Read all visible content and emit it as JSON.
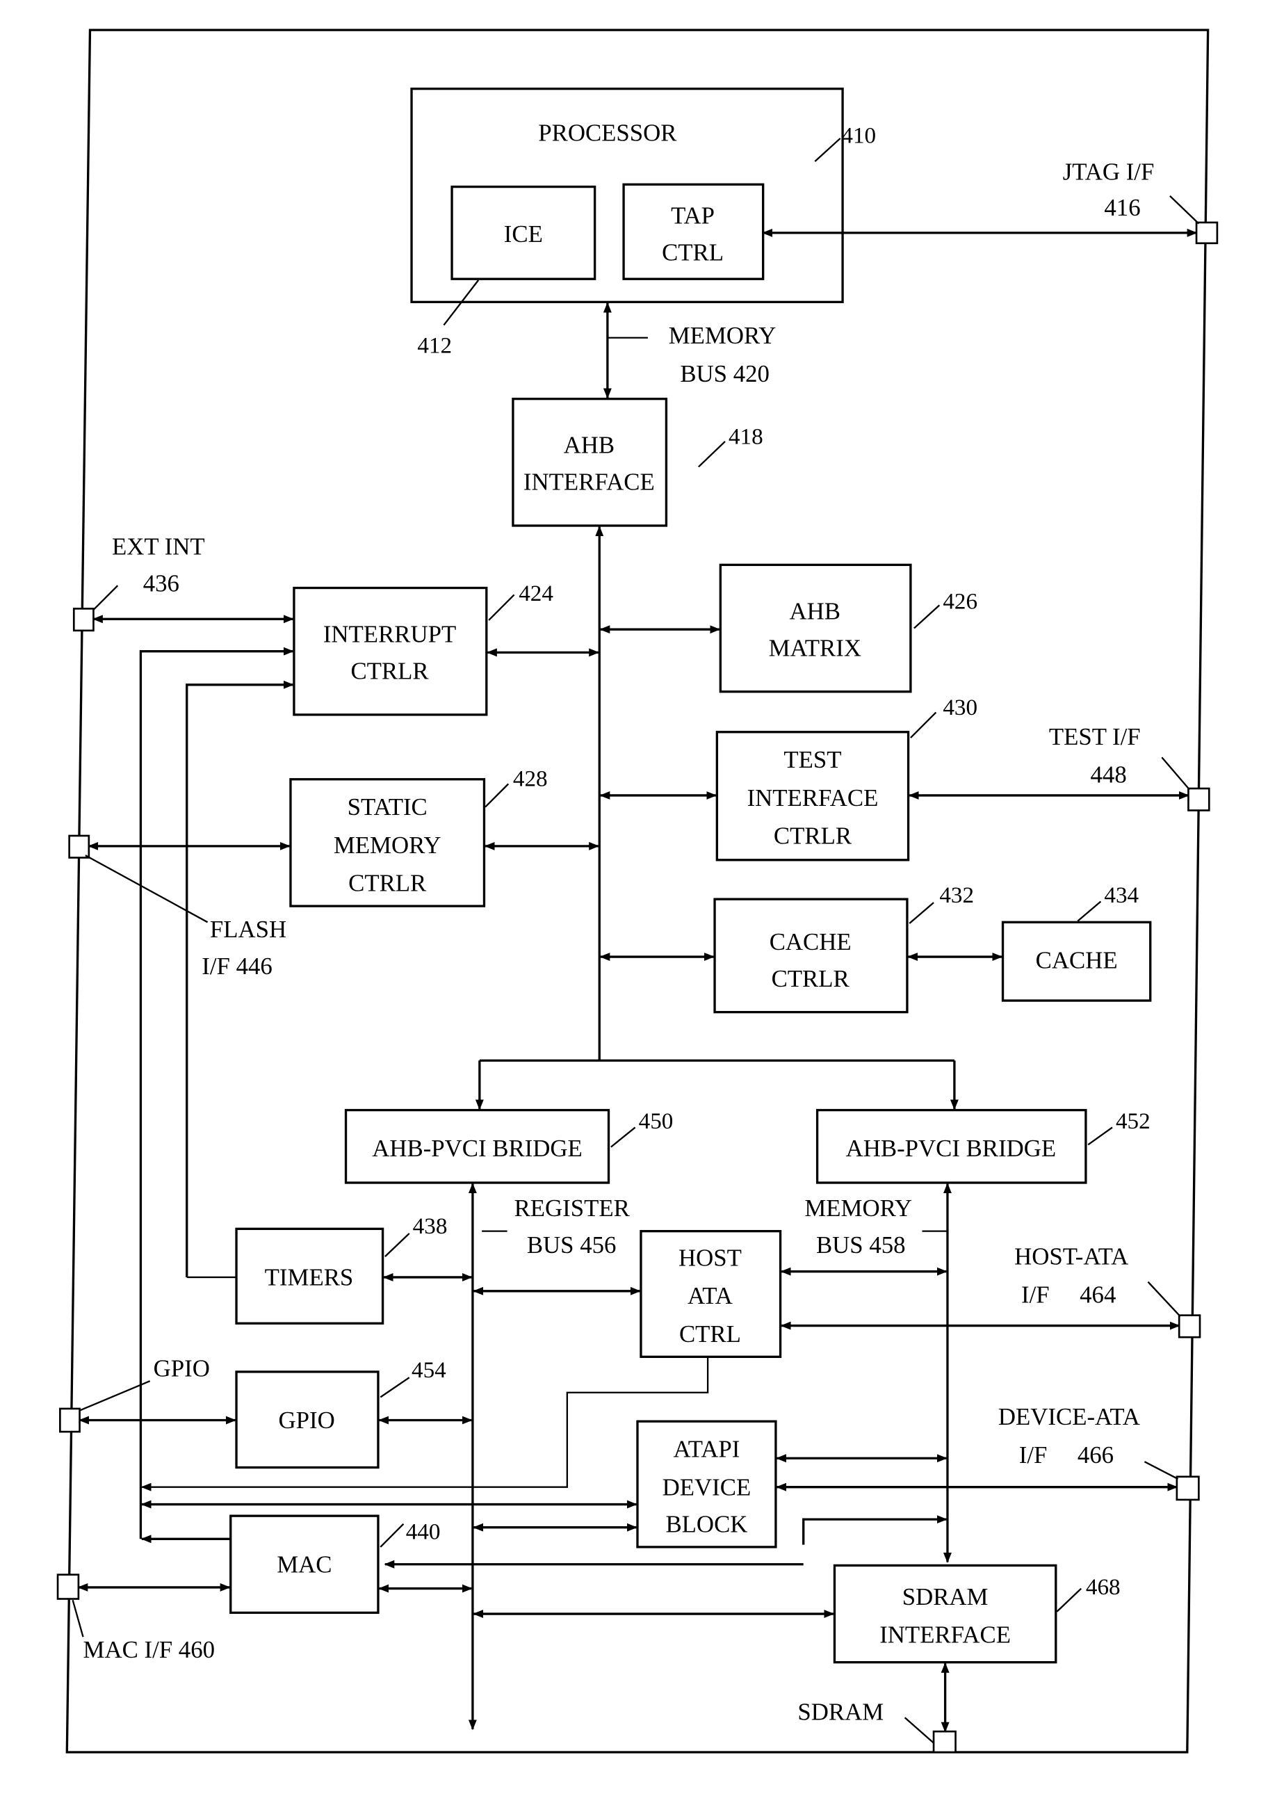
{
  "figure": {
    "blocks": {
      "processor": {
        "lines": [
          "PROCESSOR"
        ],
        "ref": "410"
      },
      "ice": {
        "lines": [
          "ICE"
        ],
        "ref": "412"
      },
      "tap_ctrl": {
        "lines": [
          "TAP",
          "CTRL"
        ]
      },
      "ahb_interface": {
        "lines": [
          "AHB",
          "INTERFACE"
        ],
        "ref": "418"
      },
      "interrupt_ctrlr": {
        "lines": [
          "INTERRUPT",
          "CTRLR"
        ],
        "ref": "424"
      },
      "ahb_matrix": {
        "lines": [
          "AHB",
          "MATRIX"
        ],
        "ref": "426"
      },
      "static_memory_ctrlr": {
        "lines": [
          "STATIC",
          "MEMORY",
          "CTRLR"
        ],
        "ref": "428"
      },
      "test_interface_ctrlr": {
        "lines": [
          "TEST",
          "INTERFACE",
          "CTRLR"
        ],
        "ref": "430"
      },
      "cache_ctrlr": {
        "lines": [
          "CACHE",
          "CTRLR"
        ],
        "ref": "432"
      },
      "cache": {
        "lines": [
          "CACHE"
        ],
        "ref": "434"
      },
      "bridge_450": {
        "lines": [
          "AHB-PVCI BRIDGE"
        ],
        "ref": "450"
      },
      "bridge_452": {
        "lines": [
          "AHB-PVCI BRIDGE"
        ],
        "ref": "452"
      },
      "timers": {
        "lines": [
          "TIMERS"
        ],
        "ref": "438"
      },
      "host_ata_ctrl": {
        "lines": [
          "HOST",
          "ATA",
          "CTRL"
        ]
      },
      "gpio": {
        "lines": [
          "GPIO"
        ],
        "ref": "454"
      },
      "atapi_device_block": {
        "lines": [
          "ATAPI",
          "DEVICE",
          "BLOCK"
        ]
      },
      "mac": {
        "lines": [
          "MAC"
        ],
        "ref": "440"
      },
      "sdram_interface": {
        "lines": [
          "SDRAM",
          "INTERFACE"
        ],
        "ref": "468"
      }
    },
    "buses": {
      "memory_bus_420": [
        "MEMORY",
        "BUS 420"
      ],
      "register_bus_456": [
        "REGISTER",
        "BUS 456"
      ],
      "memory_bus_458": [
        "MEMORY",
        "BUS 458"
      ]
    },
    "interfaces": {
      "jtag": [
        "JTAG  I/F",
        "416"
      ],
      "ext_int": [
        "EXT INT",
        "436"
      ],
      "test": [
        "TEST  I/F",
        "448"
      ],
      "flash": [
        "FLASH",
        "I/F  446"
      ],
      "host_ata": [
        "HOST-ATA",
        "I/F     464"
      ],
      "gpio": [
        "GPIO"
      ],
      "device_ata": [
        "DEVICE-ATA",
        "I/F     466"
      ],
      "mac": [
        "MAC I/F 460"
      ],
      "sdram": [
        "SDRAM"
      ]
    }
  }
}
